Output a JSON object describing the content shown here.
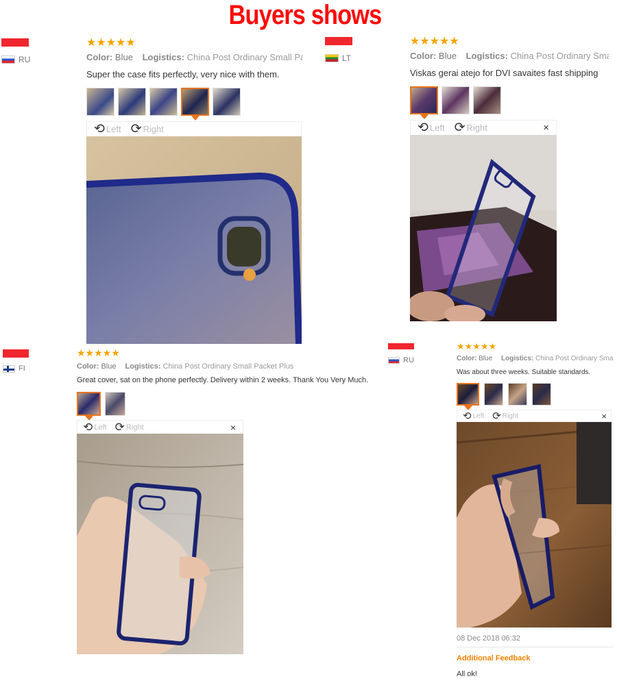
{
  "page": {
    "title": "Buyers shows"
  },
  "reviews": [
    {
      "country_code": "RU",
      "rating": "★★★★★",
      "color_label": "Color:",
      "color_value": "Blue",
      "logistics_label": "Logistics:",
      "logistics_value": "China Post Ordinary Small Pa",
      "text": "Super the case fits perfectly, very nice with them.",
      "rotate_left": "Left",
      "rotate_right": "Right"
    },
    {
      "country_code": "LT",
      "rating": "★★★★★",
      "color_label": "Color:",
      "color_value": "Blue",
      "logistics_label": "Logistics:",
      "logistics_value": "China Post Ordinary Sma",
      "text": "Viskas gerai atejo for DVI savaites fast shipping",
      "rotate_left": "Left",
      "rotate_right": "Right",
      "close": "×"
    },
    {
      "country_code": "FI",
      "rating": "★★★★★",
      "color_label": "Color:",
      "color_value": "Blue",
      "logistics_label": "Logistics:",
      "logistics_value": "China Post Ordinary Small Packet Plus",
      "text": "Great cover, sat on the phone perfectly. Delivery within 2 weeks. Thank You Very Much.",
      "rotate_left": "Left",
      "rotate_right": "Right",
      "close": "×"
    },
    {
      "country_code": "RU",
      "rating": "★★★★★",
      "color_label": "Color:",
      "color_value": "Blue",
      "logistics_label": "Logistics:",
      "logistics_value": "China Post Ordinary Sma",
      "text": "Was about three weeks. Suitable standards.",
      "rotate_left": "Left",
      "rotate_right": "Right",
      "close": "×",
      "date": "08 Dec 2018 06:32",
      "feedback_label": "Additional Feedback",
      "feedback_text": "All ok!"
    }
  ],
  "icons": {
    "rotate_left": "rotate-left-icon",
    "rotate_right": "rotate-right-icon",
    "star": "star-icon",
    "close": "close-icon"
  },
  "colors": {
    "title_red": "#ff0a0a",
    "star_orange": "#f5a300",
    "selected_orange": "#e8731d",
    "feedback_orange": "#f08200"
  }
}
